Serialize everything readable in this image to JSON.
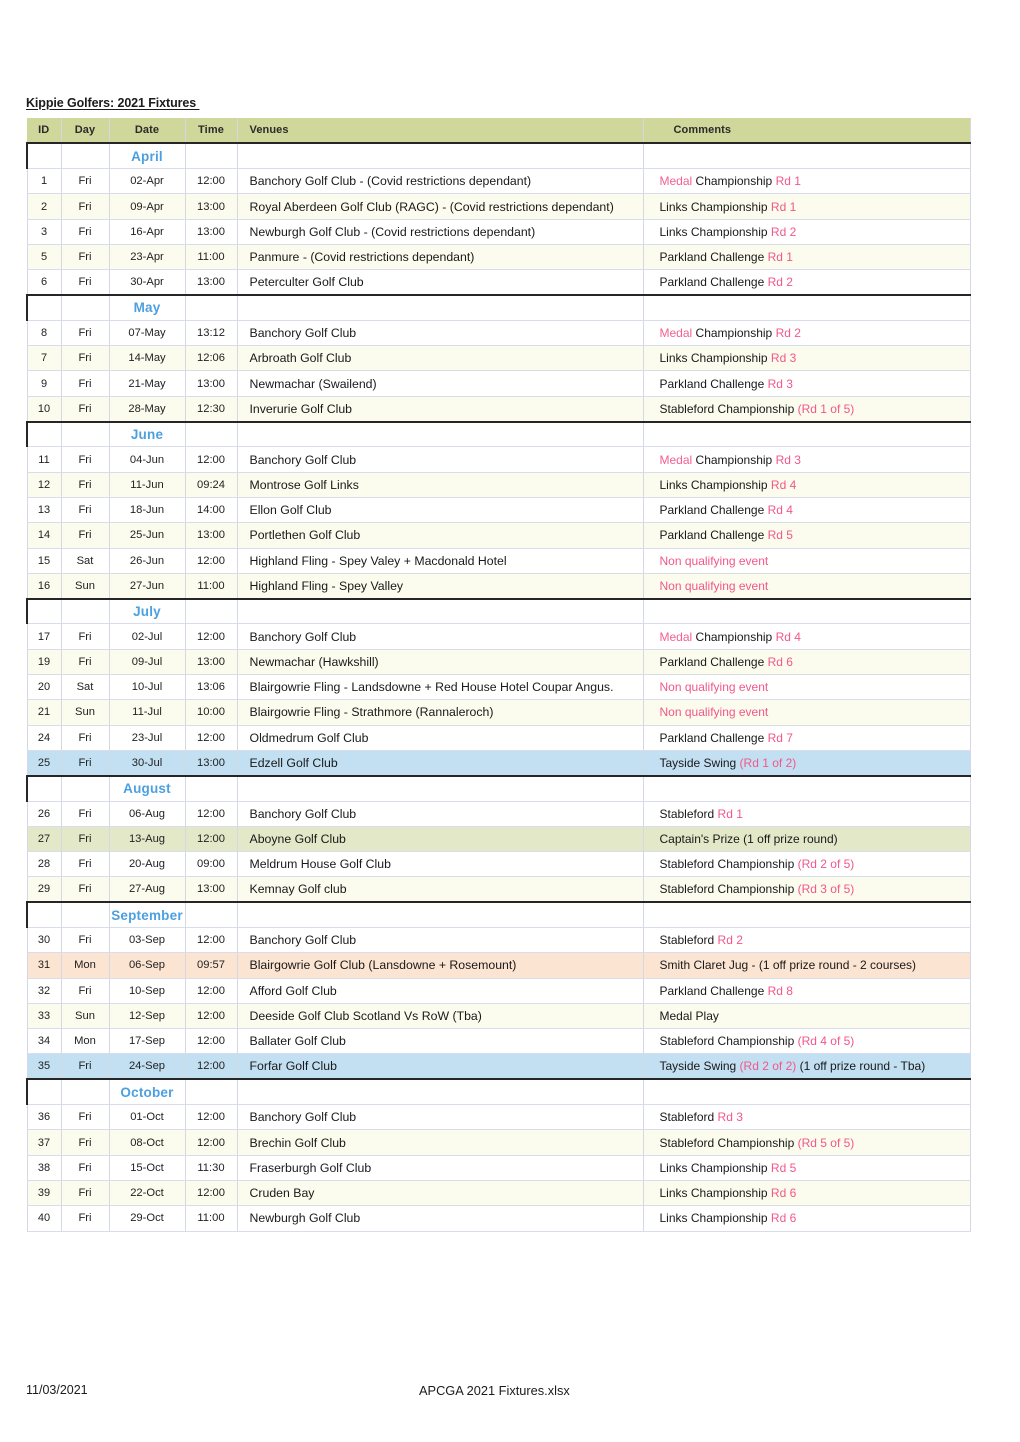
{
  "document": {
    "title": "Kippie Golfers: 2021 Fixtures ",
    "footer_date": "11/03/2021",
    "footer_filename": "APCGA 2021 Fixtures.xlsx"
  },
  "colors": {
    "header_band": "#cfd79a",
    "month_label": "#4da0e0",
    "accent_pink": "#f4608f",
    "highlight_blue": "#c2e0f2",
    "highlight_green": "#e3e8c8",
    "highlight_peach": "#fce4d2",
    "stripe": "#fbfbee"
  },
  "table": {
    "columns": [
      {
        "key": "id",
        "label": "ID"
      },
      {
        "key": "day",
        "label": "Day"
      },
      {
        "key": "date",
        "label": "Date"
      },
      {
        "key": "time",
        "label": "Time"
      },
      {
        "key": "venues",
        "label": "Venues"
      },
      {
        "key": "comments",
        "label": "Comments"
      }
    ],
    "months": [
      {
        "name": "April",
        "rows": [
          {
            "id": "1",
            "day": "Fri",
            "date": "02-Apr",
            "time": "12:00",
            "venue": "Banchory Golf Club - (Covid restrictions dependant)",
            "comment_pre": "Medal",
            "comment_mid": " Championship ",
            "comment_suffix": "Rd 1",
            "highlight": "none"
          },
          {
            "id": "2",
            "day": "Fri",
            "date": "09-Apr",
            "time": "13:00",
            "venue": "Royal Aberdeen Golf Club (RAGC) - (Covid restrictions dependant)",
            "comment_pre": "",
            "comment_mid": "Links Championship ",
            "comment_suffix": "Rd 1",
            "highlight": "none"
          },
          {
            "id": "3",
            "day": "Fri",
            "date": "16-Apr",
            "time": "13:00",
            "venue": "Newburgh Golf Club - (Covid restrictions dependant)",
            "comment_pre": "",
            "comment_mid": "Links Championship ",
            "comment_suffix": "Rd 2",
            "highlight": "none"
          },
          {
            "id": "5",
            "day": "Fri",
            "date": "23-Apr",
            "time": "11:00",
            "venue": "Panmure - (Covid restrictions dependant)",
            "comment_pre": "",
            "comment_mid": "Parkland Challenge ",
            "comment_suffix": "Rd 1",
            "highlight": "none"
          },
          {
            "id": "6",
            "day": "Fri",
            "date": "30-Apr",
            "time": "13:00",
            "venue": "Peterculter Golf Club",
            "comment_pre": "",
            "comment_mid": "Parkland Challenge ",
            "comment_suffix": "Rd 2",
            "highlight": "none"
          }
        ]
      },
      {
        "name": "May",
        "rows": [
          {
            "id": "8",
            "day": "Fri",
            "date": "07-May",
            "time": "13:12",
            "venue": "Banchory Golf Club",
            "comment_pre": "Medal",
            "comment_mid": " Championship ",
            "comment_suffix": "Rd 2",
            "highlight": "none"
          },
          {
            "id": "7",
            "day": "Fri",
            "date": "14-May",
            "time": "12:06",
            "venue": "Arbroath Golf Club",
            "comment_pre": "",
            "comment_mid": "Links Championship ",
            "comment_suffix": "Rd 3",
            "highlight": "none"
          },
          {
            "id": "9",
            "day": "Fri",
            "date": "21-May",
            "time": "13:00",
            "venue": "Newmachar (Swailend)",
            "comment_pre": "",
            "comment_mid": "Parkland Challenge ",
            "comment_suffix": "Rd 3",
            "highlight": "none"
          },
          {
            "id": "10",
            "day": "Fri",
            "date": "28-May",
            "time": "12:30",
            "venue": "Inverurie Golf Club",
            "comment_pre": "",
            "comment_mid": "Stableford Championship ",
            "comment_suffix": "(Rd 1 of 5)",
            "highlight": "none"
          }
        ]
      },
      {
        "name": "June",
        "rows": [
          {
            "id": "11",
            "day": "Fri",
            "date": "04-Jun",
            "time": "12:00",
            "venue": "Banchory Golf Club",
            "comment_pre": "Medal",
            "comment_mid": " Championship ",
            "comment_suffix": "Rd 3",
            "highlight": "none"
          },
          {
            "id": "12",
            "day": "Fri",
            "date": "11-Jun",
            "time": "09:24",
            "venue": "Montrose Golf Links",
            "comment_pre": "",
            "comment_mid": "Links Championship ",
            "comment_suffix": "Rd 4",
            "highlight": "none"
          },
          {
            "id": "13",
            "day": "Fri",
            "date": "18-Jun",
            "time": "14:00",
            "venue": "Ellon Golf Club",
            "comment_pre": "",
            "comment_mid": "Parkland Challenge ",
            "comment_suffix": "Rd 4",
            "highlight": "none"
          },
          {
            "id": "14",
            "day": "Fri",
            "date": "25-Jun",
            "time": "13:00",
            "venue": "Portlethen Golf Club",
            "comment_pre": "",
            "comment_mid": "Parkland Challenge ",
            "comment_suffix": "Rd 5",
            "highlight": "none"
          },
          {
            "id": "15",
            "day": "Sat",
            "date": "26-Jun",
            "time": "12:00",
            "venue": "Highland Fling - Spey Valey + Macdonald Hotel",
            "comment_pre": "",
            "comment_mid": "",
            "comment_suffix": "Non qualifying event",
            "highlight": "none"
          },
          {
            "id": "16",
            "day": "Sun",
            "date": "27-Jun",
            "time": "11:00",
            "venue": "Highland Fling - Spey Valley",
            "comment_pre": "",
            "comment_mid": "",
            "comment_suffix": "Non qualifying event",
            "highlight": "none"
          }
        ]
      },
      {
        "name": "July",
        "rows": [
          {
            "id": "17",
            "day": "Fri",
            "date": "02-Jul",
            "time": "12:00",
            "venue": "Banchory Golf Club",
            "comment_pre": "Medal",
            "comment_mid": " Championship ",
            "comment_suffix": "Rd 4",
            "highlight": "none"
          },
          {
            "id": "19",
            "day": "Fri",
            "date": "09-Jul",
            "time": "13:00",
            "venue": "Newmachar (Hawkshill)",
            "comment_pre": "",
            "comment_mid": "Parkland Challenge ",
            "comment_suffix": "Rd 6",
            "highlight": "none"
          },
          {
            "id": "20",
            "day": "Sat",
            "date": "10-Jul",
            "time": "13:06",
            "venue": "Blairgowrie Fling - Landsdowne + Red House Hotel Coupar Angus.",
            "comment_pre": "",
            "comment_mid": "",
            "comment_suffix": "Non qualifying event",
            "highlight": "none"
          },
          {
            "id": "21",
            "day": "Sun",
            "date": "11-Jul",
            "time": "10:00",
            "venue": "Blairgowrie Fling - Strathmore (Rannaleroch)",
            "comment_pre": "",
            "comment_mid": "",
            "comment_suffix": "Non qualifying event",
            "highlight": "none"
          },
          {
            "id": "24",
            "day": "Fri",
            "date": "23-Jul",
            "time": "12:00",
            "venue": "Oldmedrum Golf Club",
            "comment_pre": "",
            "comment_mid": "Parkland Challenge ",
            "comment_suffix": "Rd 7",
            "highlight": "none"
          },
          {
            "id": "25",
            "day": "Fri",
            "date": "30-Jul",
            "time": "13:00",
            "venue": "Edzell Golf Club",
            "comment_pre": "",
            "comment_mid": "Tayside Swing ",
            "comment_suffix": "(Rd 1 of 2)",
            "highlight": "blue"
          }
        ]
      },
      {
        "name": "August",
        "rows": [
          {
            "id": "26",
            "day": "Fri",
            "date": "06-Aug",
            "time": "12:00",
            "venue": "Banchory Golf Club",
            "comment_pre": "",
            "comment_mid": "Stableford ",
            "comment_suffix": "Rd 1",
            "highlight": "none"
          },
          {
            "id": "27",
            "day": "Fri",
            "date": "13-Aug",
            "time": "12:00",
            "venue": "Aboyne Golf Club",
            "comment_pre": "",
            "comment_mid": "Captain's Prize (1 off prize round)",
            "comment_suffix": "",
            "highlight": "green"
          },
          {
            "id": "28",
            "day": "Fri",
            "date": "20-Aug",
            "time": "09:00",
            "venue": "Meldrum House Golf Club",
            "comment_pre": "",
            "comment_mid": "Stableford Championship ",
            "comment_suffix": "(Rd 2 of 5)",
            "highlight": "none"
          },
          {
            "id": "29",
            "day": "Fri",
            "date": "27-Aug",
            "time": "13:00",
            "venue": "Kemnay Golf club",
            "comment_pre": "",
            "comment_mid": "Stableford Championship ",
            "comment_suffix": "(Rd 3 of 5)",
            "highlight": "none"
          }
        ]
      },
      {
        "name": "September",
        "rows": [
          {
            "id": "30",
            "day": "Fri",
            "date": "03-Sep",
            "time": "12:00",
            "venue": "Banchory Golf Club",
            "comment_pre": "",
            "comment_mid": "Stableford ",
            "comment_suffix": "Rd 2",
            "highlight": "none"
          },
          {
            "id": "31",
            "day": "Mon",
            "date": "06-Sep",
            "time": "09:57",
            "venue": "Blairgowrie Golf Club (Lansdowne + Rosemount)",
            "comment_pre": "",
            "comment_mid": "Smith Claret Jug - (1 off prize round - 2 courses)",
            "comment_suffix": "",
            "highlight": "peach"
          },
          {
            "id": "32",
            "day": "Fri",
            "date": "10-Sep",
            "time": "12:00",
            "venue": "Afford Golf Club",
            "comment_pre": "",
            "comment_mid": "Parkland Challenge ",
            "comment_suffix": "Rd 8",
            "highlight": "none"
          },
          {
            "id": "33",
            "day": "Sun",
            "date": "12-Sep",
            "time": "12:00",
            "venue": "Deeside Golf Club Scotland Vs RoW (Tba)",
            "comment_pre": "",
            "comment_mid": "Medal Play",
            "comment_suffix": "",
            "highlight": "none"
          },
          {
            "id": "34",
            "day": "Mon",
            "date": "17-Sep",
            "time": "12:00",
            "venue": "Ballater Golf Club",
            "comment_pre": "",
            "comment_mid": "Stableford Championship ",
            "comment_suffix": "(Rd 4 of 5)",
            "highlight": "none"
          },
          {
            "id": "35",
            "day": "Fri",
            "date": "24-Sep",
            "time": "12:00",
            "venue": "Forfar Golf Club",
            "comment_pre": "",
            "comment_mid": "Tayside Swing ",
            "comment_suffix": "(Rd 2 of 2)",
            "comment_tail": " (1 off prize round - Tba)",
            "highlight": "blue"
          }
        ]
      },
      {
        "name": "October",
        "rows": [
          {
            "id": "36",
            "day": "Fri",
            "date": "01-Oct",
            "time": "12:00",
            "venue": "Banchory Golf Club",
            "comment_pre": "",
            "comment_mid": "Stableford ",
            "comment_suffix": "Rd 3",
            "highlight": "none"
          },
          {
            "id": "37",
            "day": "Fri",
            "date": "08-Oct",
            "time": "12:00",
            "venue": "Brechin Golf Club",
            "comment_pre": "",
            "comment_mid": "Stableford Championship ",
            "comment_suffix": "(Rd 5 of 5)",
            "highlight": "none"
          },
          {
            "id": "38",
            "day": "Fri",
            "date": "15-Oct",
            "time": "11:30",
            "venue": "Fraserburgh Golf Club",
            "comment_pre": "",
            "comment_mid": "Links Championship ",
            "comment_suffix": "Rd 5",
            "highlight": "none"
          },
          {
            "id": "39",
            "day": "Fri",
            "date": "22-Oct",
            "time": "12:00",
            "venue": "Cruden Bay",
            "comment_pre": "",
            "comment_mid": "Links Championship ",
            "comment_suffix": "Rd 6",
            "highlight": "none"
          },
          {
            "id": "40",
            "day": "Fri",
            "date": "29-Oct",
            "time": "11:00",
            "venue": "Newburgh Golf Club",
            "comment_pre": "",
            "comment_mid": "Links Championship ",
            "comment_suffix": "Rd 6",
            "highlight": "none"
          }
        ]
      }
    ]
  }
}
